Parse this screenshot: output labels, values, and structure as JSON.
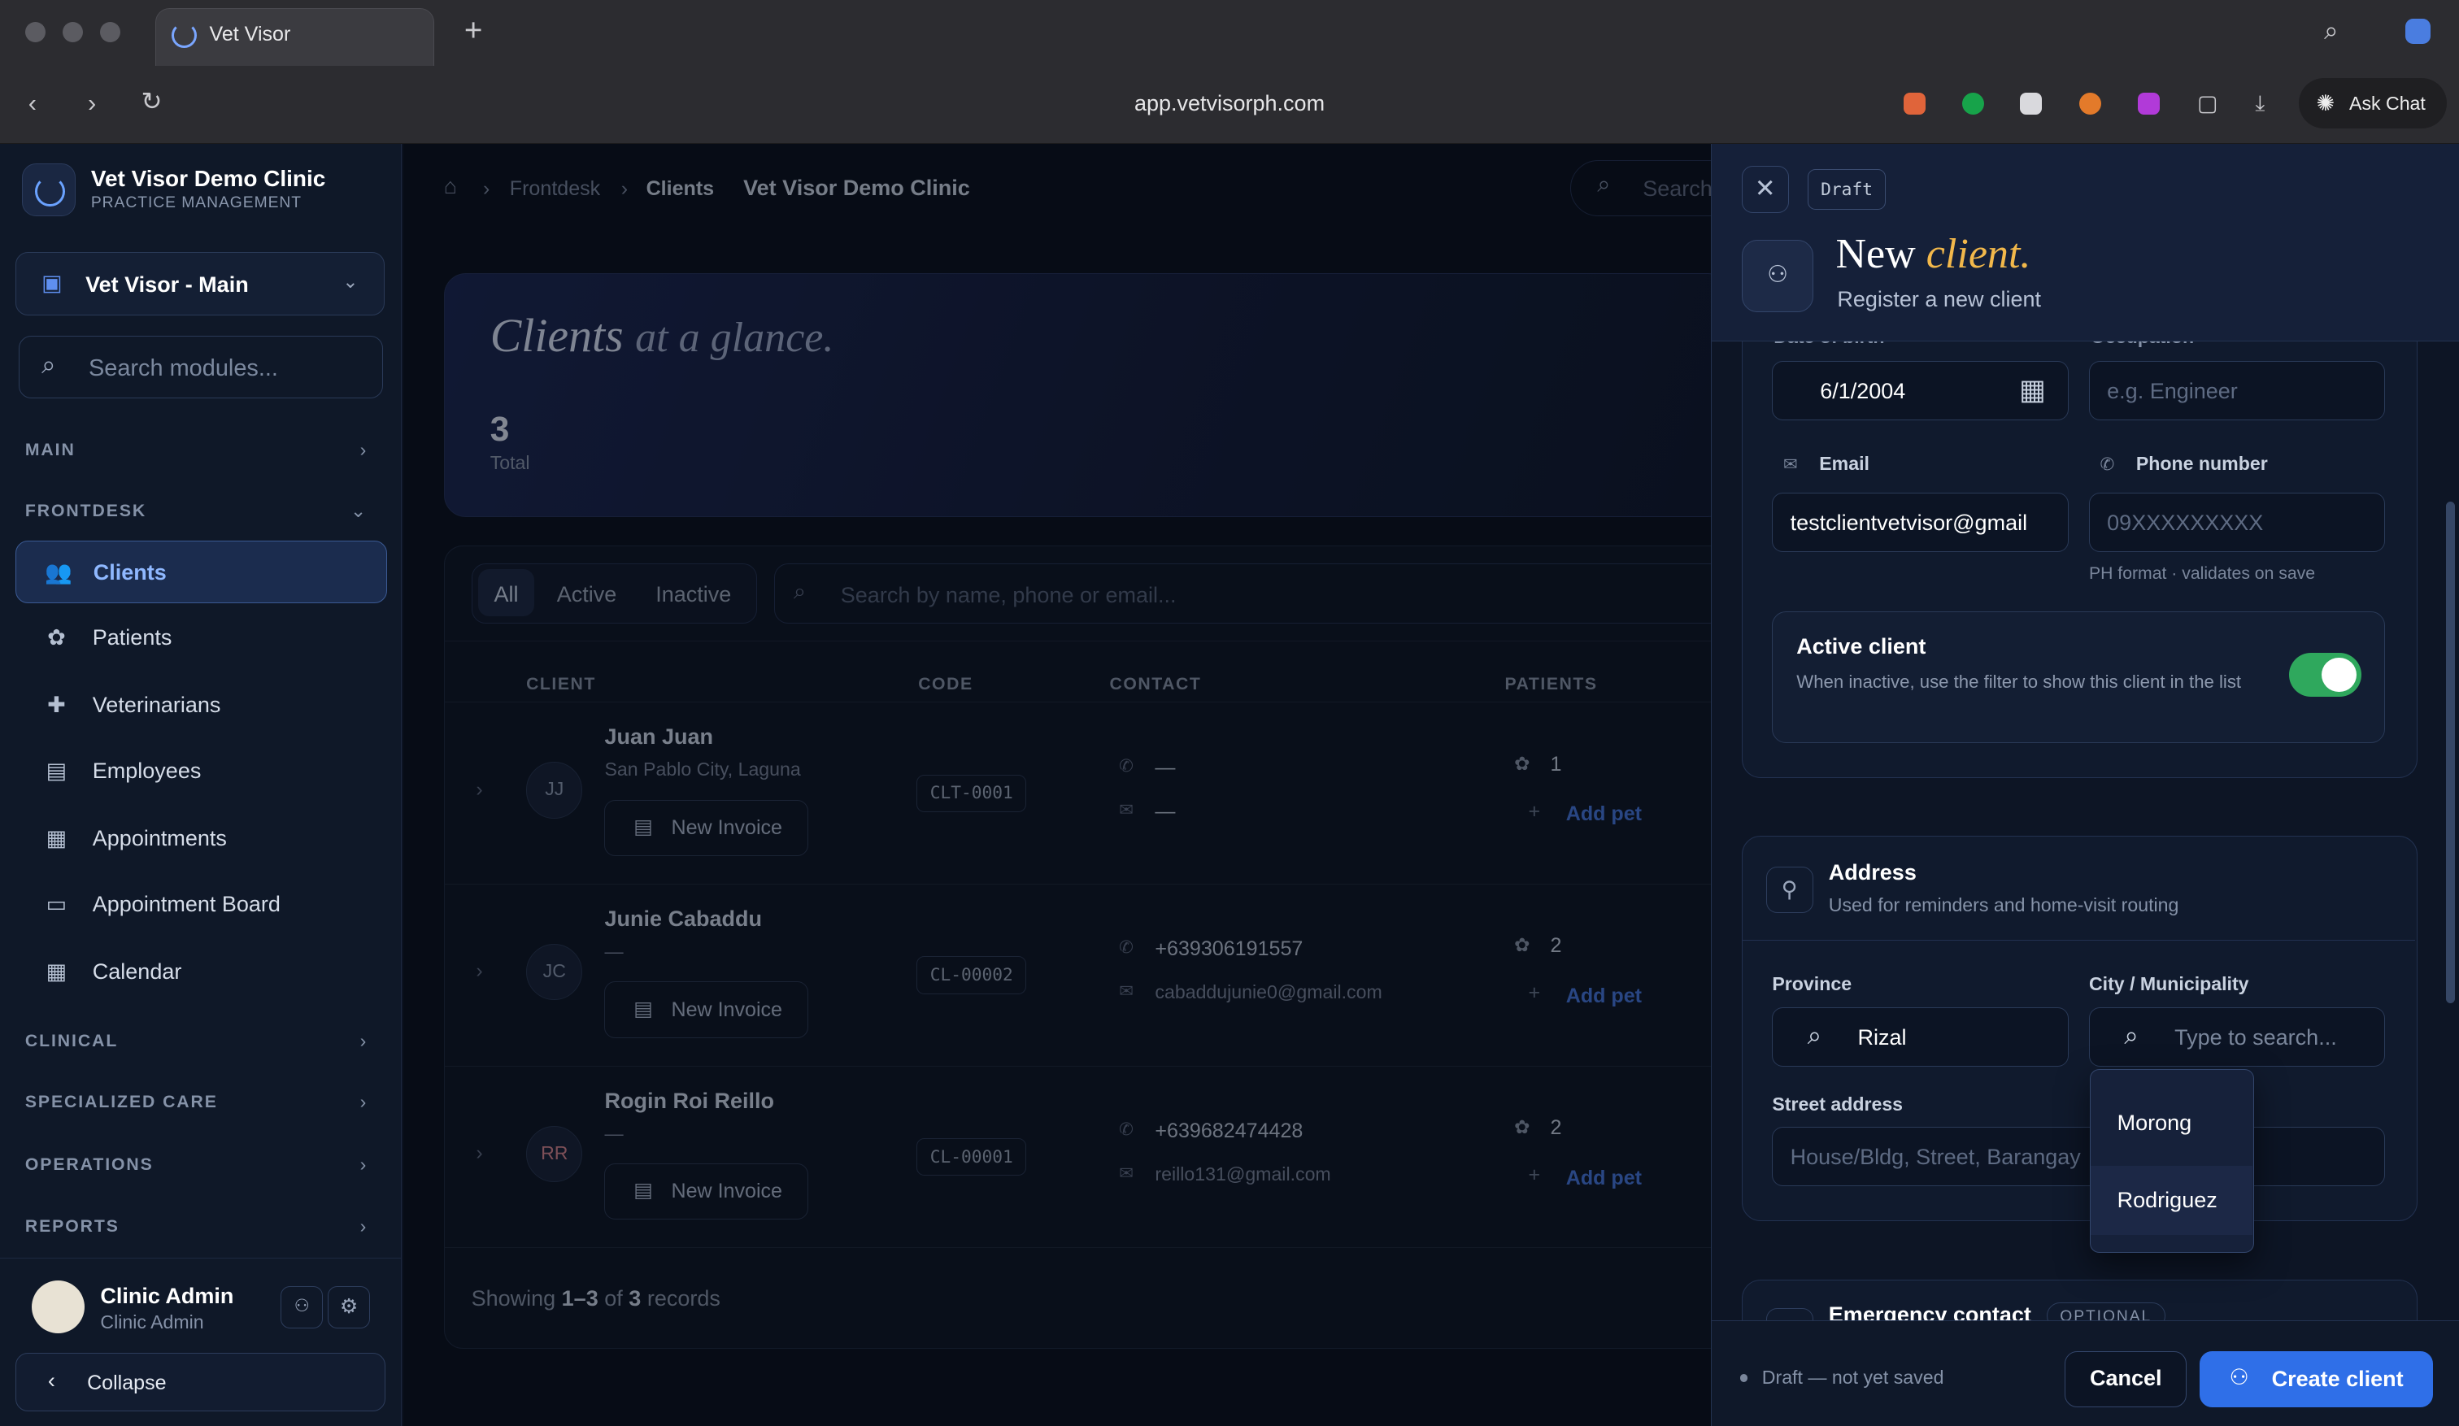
{
  "browser": {
    "tab_title": "Vet Visor",
    "url": "app.vetvisorph.com",
    "ask_chat": "Ask Chat"
  },
  "sidebar": {
    "clinic_name": "Vet Visor Demo Clinic",
    "clinic_sub": "PRACTICE MANAGEMENT",
    "branch": "Vet Visor - Main",
    "search_placeholder": "Search modules...",
    "sections": {
      "main": "MAIN",
      "frontdesk": "FRONTDESK",
      "clinical": "CLINICAL",
      "specialized": "SPECIALIZED CARE",
      "operations": "OPERATIONS",
      "reports": "REPORTS"
    },
    "items": [
      "Clients",
      "Patients",
      "Veterinarians",
      "Employees",
      "Appointments",
      "Appointment Board",
      "Calendar"
    ],
    "user_name": "Clinic Admin",
    "user_role": "Clinic Admin",
    "collapse": "Collapse"
  },
  "main": {
    "breadcrumb": [
      "Frontdesk",
      "Clients"
    ],
    "clinic": "Vet Visor Demo Clinic",
    "search": "Search",
    "hero_title_a": "Clients",
    "hero_title_b": "at a glance.",
    "total_count": "3",
    "total_label": "Total",
    "filters": [
      "All",
      "Active",
      "Inactive"
    ],
    "table_search": "Search by name, phone or email...",
    "columns": [
      "CLIENT",
      "CODE",
      "CONTACT",
      "PATIENTS"
    ],
    "rows": [
      {
        "initials": "JJ",
        "name": "Juan Juan",
        "location": "San Pablo City, Laguna",
        "code": "CLT-0001",
        "phone": "—",
        "email": "—",
        "pets": "1"
      },
      {
        "initials": "JC",
        "name": "Junie Cabaddu",
        "location": "—",
        "code": "CL-00002",
        "phone": "+639306191557",
        "email": "cabaddujunie0@gmail.com",
        "pets": "2"
      },
      {
        "initials": "RR",
        "name": "Rogin Roi Reillo",
        "location": "—",
        "code": "CL-00001",
        "phone": "+639682474428",
        "email": "reillo131@gmail.com",
        "pets": "2"
      }
    ],
    "new_invoice": "New Invoice",
    "add_pet": "Add pet",
    "showing_a": "Showing",
    "showing_range": "1–3",
    "showing_of": "of",
    "showing_total": "3",
    "showing_b": "records"
  },
  "drawer": {
    "draft": "Draft",
    "title_a": "New",
    "title_b": "client.",
    "subtitle": "Register a new client",
    "dob_label": "Date of birth",
    "dob_value": "6/1/2004",
    "occupation_label": "Occupation",
    "occupation_placeholder": "e.g. Engineer",
    "email_label": "Email",
    "email_value": "testclientvetvisor@gmail",
    "phone_label": "Phone number",
    "phone_placeholder": "09XXXXXXXXX",
    "phone_hint": "PH format · validates on save",
    "active_title": "Active client",
    "active_desc": "When inactive, use the filter to show this client in the list",
    "address_title": "Address",
    "address_desc": "Used for reminders and home-visit routing",
    "province_label": "Province",
    "province_value": "Rizal",
    "city_label": "City / Municipality",
    "city_placeholder": "Type to search...",
    "street_label": "Street address",
    "street_placeholder": "House/Bldg, Street, Barangay",
    "city_options": [
      "Morong",
      "Rodriguez"
    ],
    "emergency_title": "Emergency contact",
    "emergency_tag": "OPTIONAL",
    "footer_status": "Draft — not yet saved",
    "cancel": "Cancel",
    "create": "Create client"
  },
  "colors": {
    "accent": "#2f6fe8",
    "toggle_on": "#2fa85d",
    "title_accent": "#f2b84b"
  }
}
